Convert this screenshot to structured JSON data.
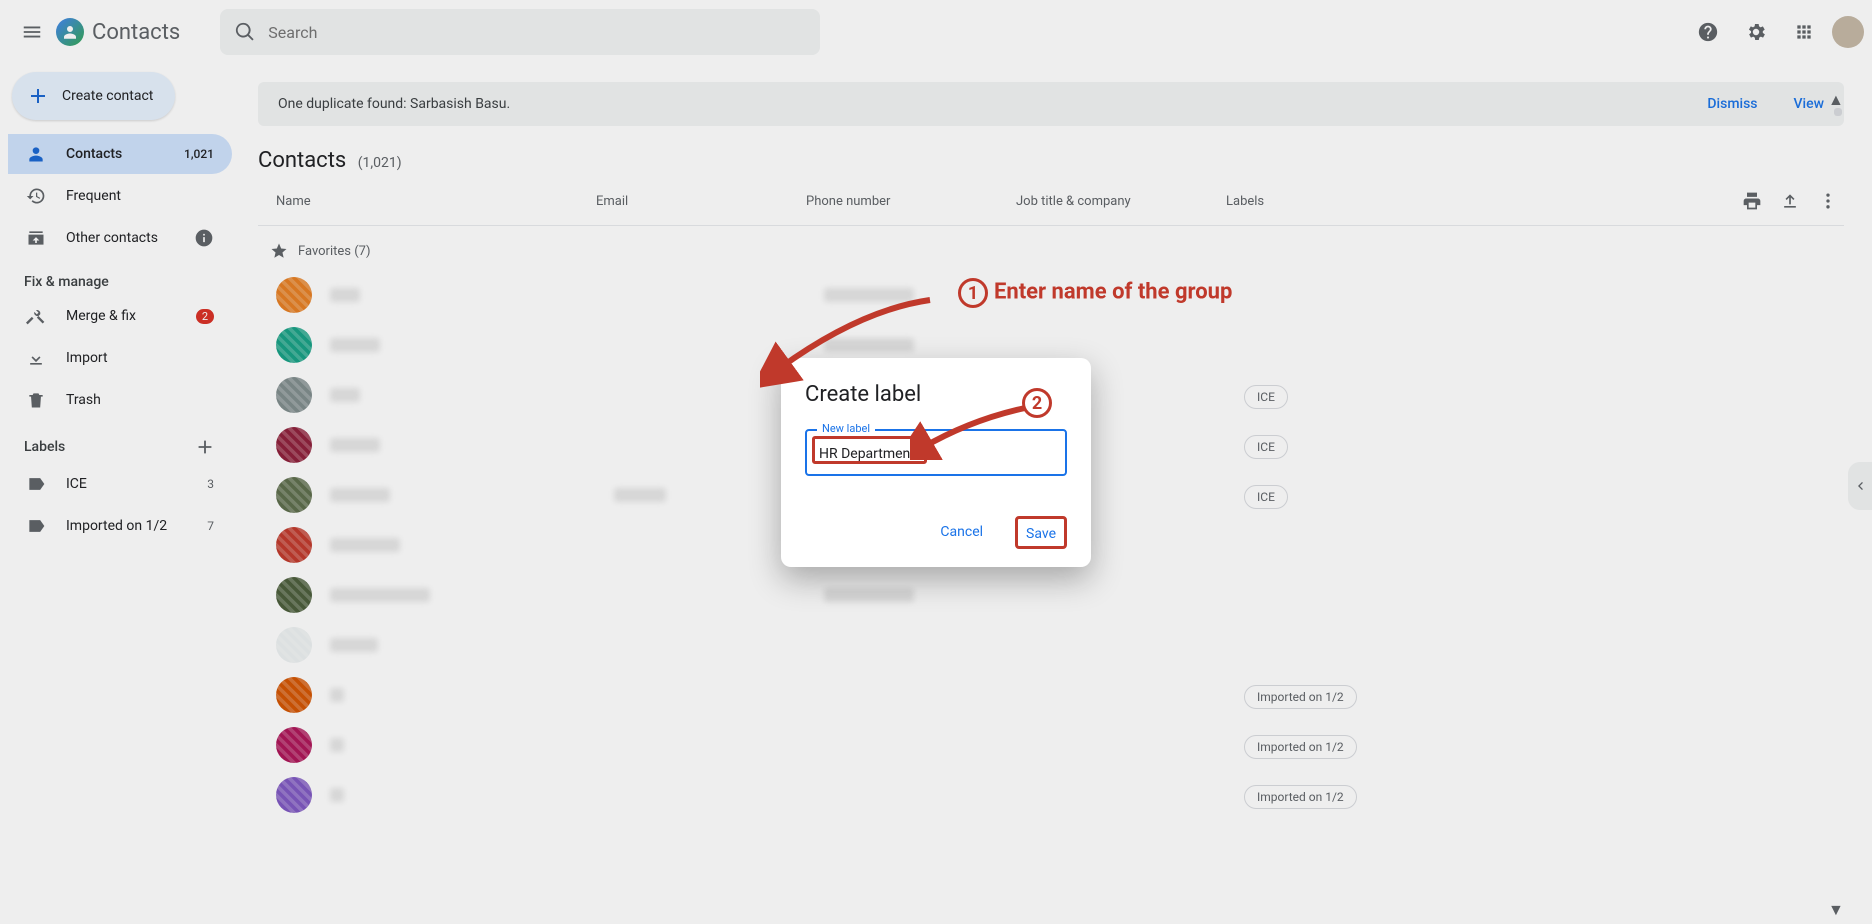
{
  "header": {
    "app_name": "Contacts",
    "search_placeholder": "Search"
  },
  "sidebar": {
    "create_label": "Create contact",
    "nav": [
      {
        "label": "Contacts",
        "count": "1,021"
      },
      {
        "label": "Frequent"
      },
      {
        "label": "Other contacts"
      }
    ],
    "fix_section": "Fix & manage",
    "fix_items": [
      {
        "label": "Merge & fix",
        "badge": "2"
      },
      {
        "label": "Import"
      },
      {
        "label": "Trash"
      }
    ],
    "labels_section": "Labels",
    "labels": [
      {
        "label": "ICE",
        "count": "3"
      },
      {
        "label": "Imported on 1/2",
        "count": "7"
      }
    ]
  },
  "banner": {
    "text": "One duplicate found: Sarbasish Basu.",
    "dismiss": "Dismiss",
    "view": "View"
  },
  "page": {
    "title": "Contacts",
    "count": "(1,021)",
    "columns": {
      "name": "Name",
      "email": "Email",
      "phone": "Phone number",
      "job": "Job title & company",
      "labels": "Labels"
    },
    "favorites": "Favorites (7)"
  },
  "rows": [
    {
      "color": "#e67e22",
      "name_w": 30,
      "phone_w": 90,
      "label": ""
    },
    {
      "color": "#16a085",
      "name_w": 50,
      "phone_w": 90,
      "label": ""
    },
    {
      "color": "#7f8c8d",
      "name_w": 30,
      "phone_w": 0,
      "label": "ICE"
    },
    {
      "color": "#8e1f3a",
      "name_w": 50,
      "phone_w": 0,
      "label": "ICE"
    },
    {
      "color": "#5d6d4b",
      "name_w": 60,
      "phone_w": 0,
      "label": "ICE",
      "email_w": 52
    },
    {
      "color": "#c0392b",
      "name_w": 70,
      "phone_w": 90,
      "label": ""
    },
    {
      "color": "#4a5d3a",
      "name_w": 100,
      "phone_w": 90,
      "label": ""
    },
    {
      "color": "#ecf0f1",
      "name_w": 48,
      "phone_w": 0,
      "label": "",
      "light": true
    },
    {
      "color": "#d35400",
      "name_w": 14,
      "phone_w": 0,
      "label": "Imported on 1/2"
    },
    {
      "color": "#ad1457",
      "name_w": 14,
      "phone_w": 0,
      "label": "Imported on 1/2"
    },
    {
      "color": "#7e57c2",
      "name_w": 14,
      "phone_w": 0,
      "label": "Imported on 1/2"
    }
  ],
  "dialog": {
    "title": "Create label",
    "field_label": "New label",
    "field_value": "HR Department",
    "cancel": "Cancel",
    "save": "Save"
  },
  "annotations": {
    "step1_num": "1",
    "step1_text": "Enter name of the group",
    "step2_num": "2"
  }
}
